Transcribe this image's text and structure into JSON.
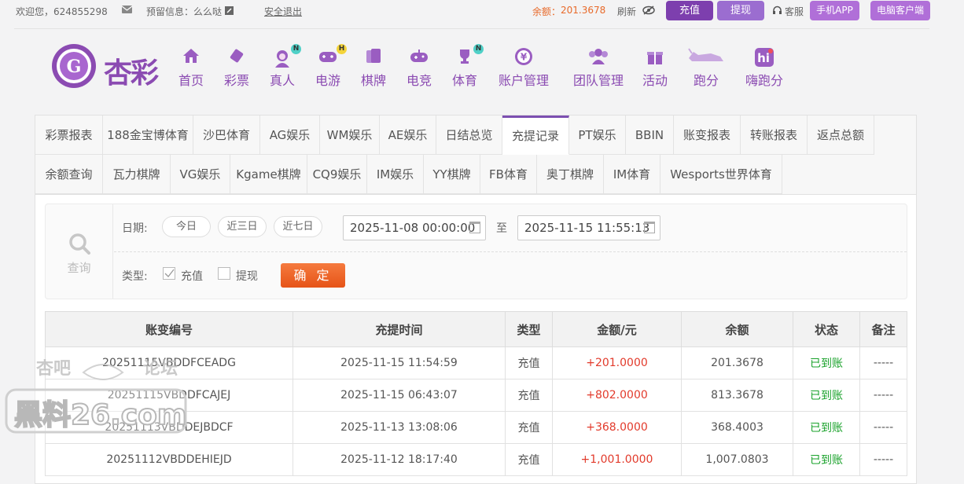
{
  "topbar": {
    "welcome": "欢迎您，624855298",
    "reserved_info": "预留信息：么么哒",
    "logout": "安全退出",
    "balance_label": "余额：",
    "balance_value": "201.3678",
    "refresh": "刷新",
    "deposit": "充值",
    "withdraw": "提现",
    "service": "客服",
    "mobile_app": "手机APP",
    "pc_client": "电脑客户端"
  },
  "logo_text": "杏彩",
  "nav": [
    {
      "label": "首页",
      "icon": "home-icon"
    },
    {
      "label": "彩票",
      "icon": "lottery-icon"
    },
    {
      "label": "真人",
      "icon": "live-dealer-icon",
      "badge": "N"
    },
    {
      "label": "电游",
      "icon": "slot-game-icon",
      "badge": "H"
    },
    {
      "label": "棋牌",
      "icon": "cards-icon"
    },
    {
      "label": "电竞",
      "icon": "gamepad-icon"
    },
    {
      "label": "体育",
      "icon": "trophy-icon",
      "badge": "N"
    },
    {
      "label": "账户管理",
      "icon": "yen-icon"
    },
    {
      "label": "团队管理",
      "icon": "team-icon"
    },
    {
      "label": "活动",
      "icon": "gift-icon"
    },
    {
      "label": "跑分",
      "icon": "rhino-icon"
    },
    {
      "label": "嗨跑分",
      "icon": "hi-icon"
    }
  ],
  "tabs_row1": [
    "彩票报表",
    "188金宝博体育",
    "沙巴体育",
    "AG娱乐",
    "WM娱乐",
    "AE娱乐",
    "日结总览",
    "充提记录",
    "PT娱乐",
    "BBIN",
    "账变报表",
    "转账报表",
    "返点总额"
  ],
  "tabs_row2": [
    "余额查询",
    "瓦力棋牌",
    "VG娱乐",
    "Kgame棋牌",
    "CQ9娱乐",
    "IM娱乐",
    "YY棋牌",
    "FB体育",
    "奥丁棋牌",
    "IM体育",
    "Wesports世界体育"
  ],
  "active_tab": "充提记录",
  "query": {
    "search_label": "查询",
    "date_label": "日期:",
    "today": "今日",
    "last3": "近三日",
    "last7": "近七日",
    "date_from": "2025-11-08 00:00:00",
    "to": "至",
    "date_to": "2025-11-15 11:55:13",
    "type_label": "类型:",
    "type_deposit": "充值",
    "type_withdraw": "提现",
    "confirm": "确 定"
  },
  "table": {
    "headers": [
      "账变编号",
      "充提时间",
      "类型",
      "金额/元",
      "余额",
      "状态",
      "备注"
    ],
    "rows": [
      [
        "20251115VBDDFCEADG",
        "2025-11-15 11:54:59",
        "充值",
        "+201.0000",
        "201.3678",
        "已到账",
        "-----"
      ],
      [
        "20251115VBDDFCAJEJ",
        "2025-11-15 06:43:07",
        "充值",
        "+802.0000",
        "813.3678",
        "已到账",
        "-----"
      ],
      [
        "20251113VBDDEJBDCF",
        "2025-11-13 13:08:06",
        "充值",
        "+368.0000",
        "368.4003",
        "已到账",
        "-----"
      ],
      [
        "20251112VBDDEHIEJD",
        "2025-11-12 18:17:40",
        "充值",
        "+1,001.0000",
        "1,007.0803",
        "已到账",
        "-----"
      ]
    ]
  },
  "watermark": {
    "line1": "杏吧",
    "line2": "论坛",
    "line3": "黑料26.com"
  },
  "colors": {
    "brand_purple": "#8b4bb2",
    "deposit_btn": "#7d3fae",
    "withdraw_btn": "#9b6dd0",
    "app_btn": "#b06fd8",
    "balance": "#e86a2a",
    "amount_red": "#e23a2b",
    "status_green": "#1aa22b",
    "confirm_orange": "#ec5f22"
  }
}
